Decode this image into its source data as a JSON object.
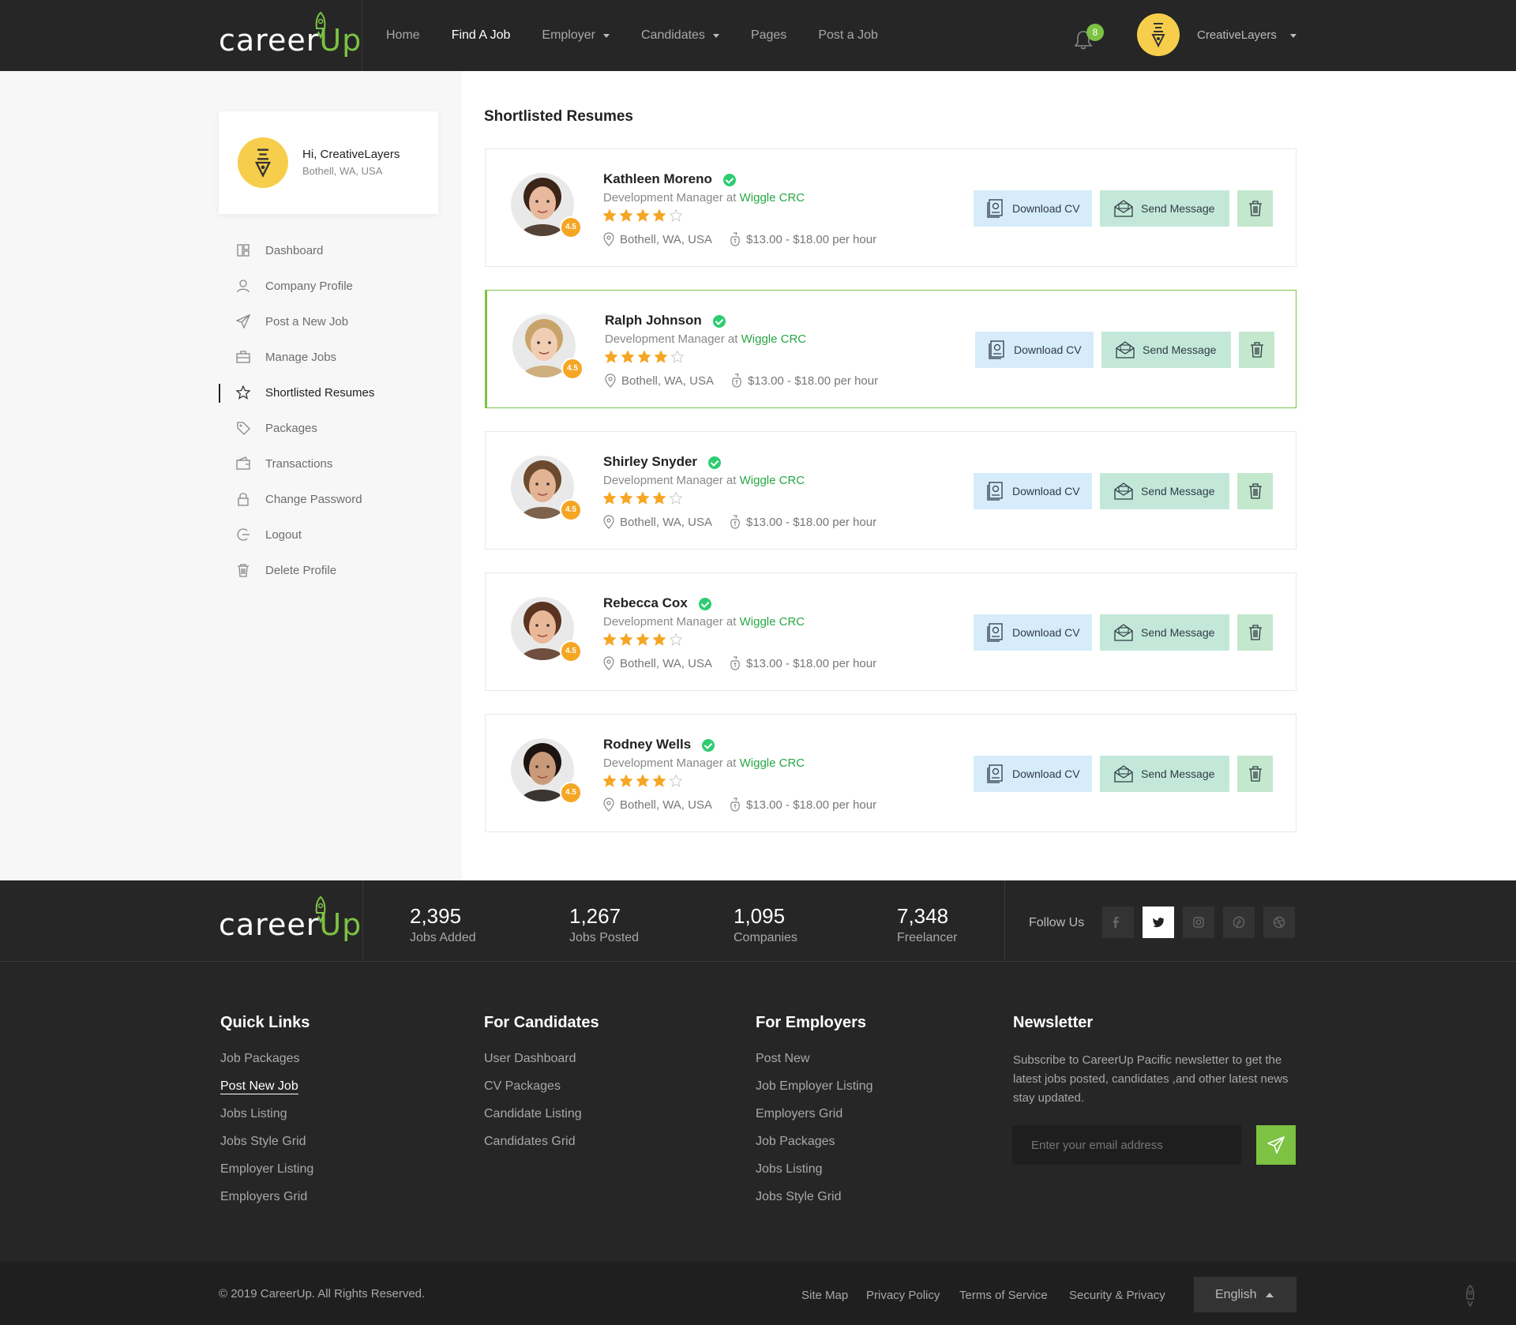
{
  "header": {
    "logo_main": "career",
    "logo_accent": "Up",
    "nav": [
      {
        "label": "Home",
        "active": false,
        "dropdown": false
      },
      {
        "label": "Find A Job",
        "active": true,
        "dropdown": false
      },
      {
        "label": "Employer",
        "active": false,
        "dropdown": true
      },
      {
        "label": "Candidates",
        "active": false,
        "dropdown": true
      },
      {
        "label": "Pages",
        "active": false,
        "dropdown": false
      },
      {
        "label": "Post a Job",
        "active": false,
        "dropdown": false
      }
    ],
    "notification_count": "8",
    "username": "CreativeLayers"
  },
  "sidebar": {
    "greeting": "Hi, CreativeLayers",
    "location": "Bothell, WA, USA",
    "menu": [
      {
        "label": "Dashboard",
        "icon": "dashboard-icon"
      },
      {
        "label": "Company Profile",
        "icon": "user-icon"
      },
      {
        "label": "Post a New Job",
        "icon": "paper-plane-icon"
      },
      {
        "label": "Manage Jobs",
        "icon": "briefcase-icon"
      },
      {
        "label": "Shortlisted Resumes",
        "icon": "star-icon",
        "active": true
      },
      {
        "label": "Packages",
        "icon": "tag-icon"
      },
      {
        "label": "Transactions",
        "icon": "wallet-icon"
      },
      {
        "label": "Change Password",
        "icon": "lock-icon"
      },
      {
        "label": "Logout",
        "icon": "logout-icon"
      },
      {
        "label": "Delete Profile",
        "icon": "trash-icon"
      }
    ]
  },
  "main": {
    "title": "Shortlisted Resumes",
    "role_prefix": "Development Manager at",
    "company": "Wiggle CRC",
    "location": "Bothell, WA, USA",
    "rate": "$13.00 - $18.00 per hour",
    "rating": "4.5",
    "stars_filled": 4,
    "stars_total": 5,
    "download_label": "Download CV",
    "message_label": "Send Message",
    "candidates": [
      {
        "name": "Kathleen Moreno",
        "highlight": false,
        "skin": "#e8b99c",
        "hair": "#3b2418"
      },
      {
        "name": "Ralph Johnson",
        "highlight": true,
        "skin": "#f1cdb4",
        "hair": "#c9a46a"
      },
      {
        "name": "Shirley Snyder",
        "highlight": false,
        "skin": "#e3b393",
        "hair": "#6b4a2f"
      },
      {
        "name": "Rebecca Cox",
        "highlight": false,
        "skin": "#e9b898",
        "hair": "#5a3420"
      },
      {
        "name": "Rodney Wells",
        "highlight": false,
        "skin": "#c99a7a",
        "hair": "#1c1410"
      }
    ]
  },
  "footer": {
    "stats": [
      {
        "value": "2,395",
        "label": "Jobs Added"
      },
      {
        "value": "1,267",
        "label": "Jobs Posted"
      },
      {
        "value": "1,095",
        "label": "Companies"
      },
      {
        "value": "7,348",
        "label": "Freelancer"
      }
    ],
    "follow_label": "Follow Us",
    "social": [
      "facebook-icon",
      "twitter-icon",
      "instagram-icon",
      "pinterest-icon",
      "dribbble-icon"
    ],
    "columns": [
      {
        "title": "Quick Links",
        "links": [
          "Job Packages",
          "Post New Job",
          "Jobs Listing",
          "Jobs Style Grid",
          "Employer Listing",
          "Employers Grid"
        ]
      },
      {
        "title": "For Candidates",
        "links": [
          "User Dashboard",
          "CV Packages",
          "Candidate Listing",
          "Candidates Grid"
        ]
      },
      {
        "title": "For Employers",
        "links": [
          "Post New",
          "Job Employer Listing",
          "Employers Grid",
          "Job Packages",
          "Jobs Listing",
          "Jobs Style Grid"
        ]
      }
    ],
    "newsletter": {
      "title": "Newsletter",
      "text": "Subscribe to CareerUp Pacific newsletter to get the latest jobs posted, candidates ,and other latest news stay updated.",
      "placeholder": "Enter your email address"
    },
    "copyright": "© 2019 CareerUp. All Rights Reserved.",
    "bottom_links": [
      "Site Map",
      "Privacy Policy",
      "Terms of Service",
      "Security & Privacy"
    ],
    "language": "English"
  },
  "colors": {
    "accent": "#7dc243",
    "dark": "#262626",
    "star": "#f5a623",
    "company_link": "#28a745"
  }
}
